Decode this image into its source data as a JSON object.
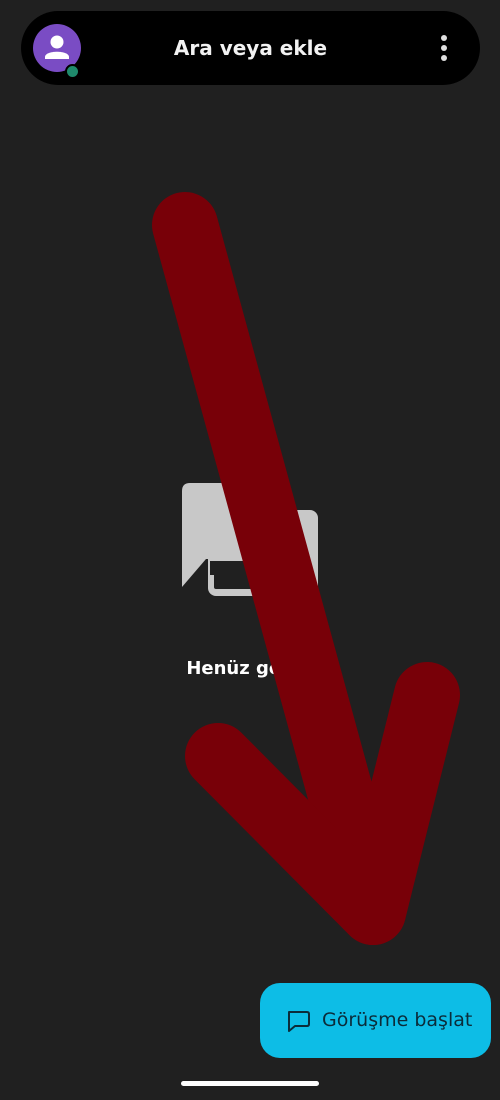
{
  "header": {
    "search_label": "Ara veya ekle",
    "avatar_icon": "person-icon",
    "menu_icon": "more-vert-icon"
  },
  "empty_state": {
    "icon": "chat-bubbles-icon",
    "text": "Henüz görüş"
  },
  "fab": {
    "label": "Görüşme başlat",
    "icon": "chat-bubble-outline-icon"
  },
  "overlay": {
    "icon": "arrow-down-right-icon"
  },
  "colors": {
    "background": "#202020",
    "header_bg": "#000000",
    "avatar": "#7a4cc4",
    "status": "#1f8a6c",
    "accent": "#0dbde6",
    "arrow": "#780008"
  }
}
